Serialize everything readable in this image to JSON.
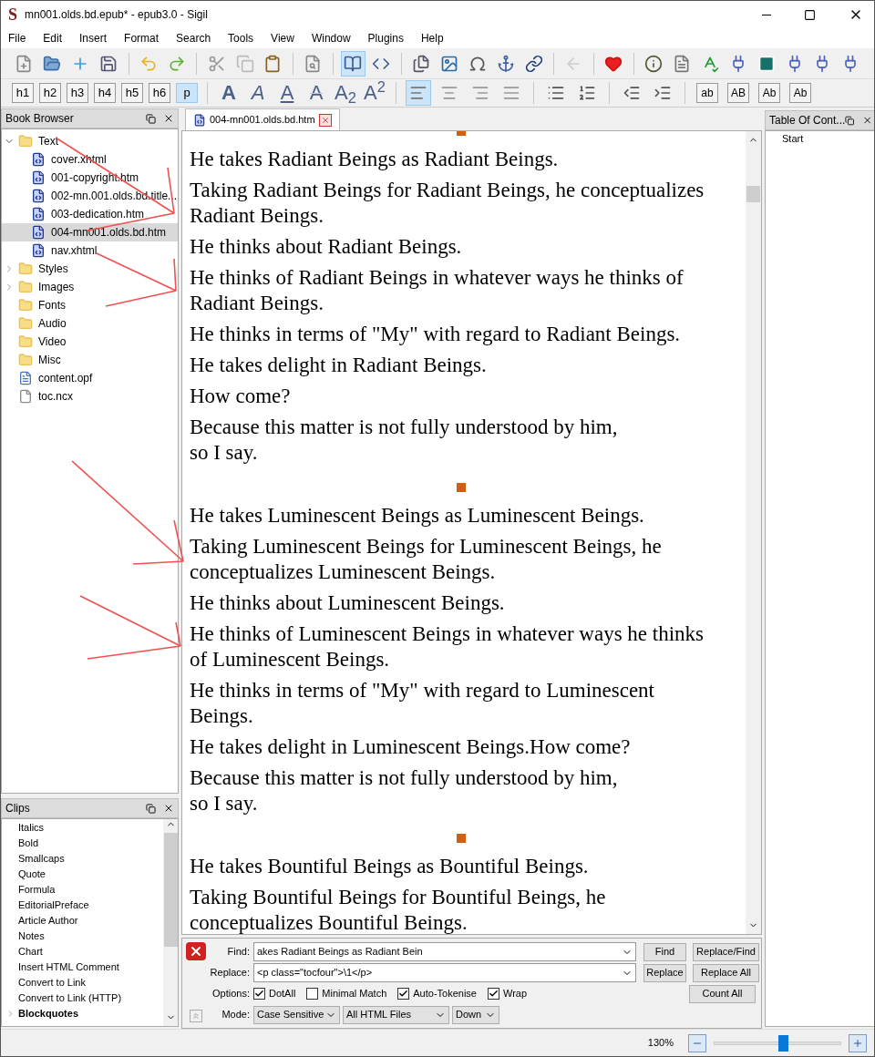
{
  "window": {
    "logo": "S",
    "title": "mn001.olds.bd.epub* - epub3.0 - Sigil"
  },
  "menu": [
    "File",
    "Edit",
    "Insert",
    "Format",
    "Search",
    "Tools",
    "View",
    "Window",
    "Plugins",
    "Help"
  ],
  "heading_buttons": [
    {
      "label": "h1",
      "selected": false
    },
    {
      "label": "h2",
      "selected": false
    },
    {
      "label": "h3",
      "selected": false
    },
    {
      "label": "h4",
      "selected": false
    },
    {
      "label": "h5",
      "selected": false
    },
    {
      "label": "h6",
      "selected": false
    },
    {
      "label": "p",
      "selected": true
    }
  ],
  "format_buttons": [
    {
      "label": "A",
      "kind": "bold"
    },
    {
      "label": "A",
      "kind": "italic"
    },
    {
      "label": "A",
      "kind": "underline"
    },
    {
      "label": "A",
      "kind": "strike"
    },
    {
      "label": "A$_{2}$",
      "kind": "plain"
    },
    {
      "label": "A$^{2}$",
      "kind": "plain"
    }
  ],
  "case_buttons": [
    "ab",
    "AB",
    "Ab",
    "Ab"
  ],
  "book_browser": {
    "title": "Book Browser",
    "items": [
      {
        "name": "Text",
        "kind": "folder",
        "expanded": true,
        "selected": false,
        "children": [
          {
            "name": "cover.xhtml",
            "kind": "html",
            "selected": false
          },
          {
            "name": "001-copyright.htm",
            "kind": "html",
            "selected": false
          },
          {
            "name": "002-mn.001.olds.bd.title....",
            "kind": "html",
            "selected": false
          },
          {
            "name": "003-dedication.htm",
            "kind": "html",
            "selected": false
          },
          {
            "name": "004-mn001.olds.bd.htm",
            "kind": "html",
            "selected": true
          },
          {
            "name": "nav.xhtml",
            "kind": "html",
            "selected": false
          }
        ]
      },
      {
        "name": "Styles",
        "kind": "folder",
        "expanded": false,
        "selected": false
      },
      {
        "name": "Images",
        "kind": "folder",
        "expanded": false,
        "selected": false
      },
      {
        "name": "Fonts",
        "kind": "folder",
        "selected": false
      },
      {
        "name": "Audio",
        "kind": "folder",
        "selected": false
      },
      {
        "name": "Video",
        "kind": "folder",
        "selected": false
      },
      {
        "name": "Misc",
        "kind": "folder",
        "selected": false
      },
      {
        "name": "content.opf",
        "kind": "opf",
        "selected": false
      },
      {
        "name": "toc.ncx",
        "kind": "file",
        "selected": false
      }
    ]
  },
  "clips": {
    "title": "Clips",
    "items": [
      {
        "name": "Italics",
        "kind": "clip"
      },
      {
        "name": "Bold",
        "kind": "clip"
      },
      {
        "name": "Smallcaps",
        "kind": "clip"
      },
      {
        "name": "Quote",
        "kind": "clip"
      },
      {
        "name": "Formula",
        "kind": "clip"
      },
      {
        "name": "EditorialPreface",
        "kind": "clip"
      },
      {
        "name": "Article Author",
        "kind": "clip"
      },
      {
        "name": "Notes",
        "kind": "clip"
      },
      {
        "name": "Chart",
        "kind": "clip"
      },
      {
        "name": "Insert HTML Comment",
        "kind": "clip"
      },
      {
        "name": "Convert to Link",
        "kind": "clip"
      },
      {
        "name": "Convert to Link (HTTP)",
        "kind": "clip"
      },
      {
        "name": "Blockquotes",
        "kind": "group"
      }
    ]
  },
  "editor": {
    "tab": "004-mn001.olds.bd.htm",
    "sections": [
      {
        "paragraphs": [
          [
            "He takes Radiant Beings as Radiant Beings."
          ],
          [
            "Taking Radiant Beings for Radiant Beings, he conceptualizes Radiant Beings."
          ],
          [
            "He thinks about Radiant Beings."
          ],
          [
            "He thinks of Radiant Beings in whatever ways he thinks of Radiant Beings."
          ],
          [
            "He thinks in terms of \"My\" with regard to Radiant Beings."
          ],
          [
            "He takes delight in Radiant Beings."
          ],
          [
            "How come?"
          ],
          [
            "Because this matter is not fully understood by him,",
            "so I say."
          ]
        ]
      },
      {
        "paragraphs": [
          [
            "He takes Luminescent Beings as Luminescent Beings."
          ],
          [
            "Taking Luminescent Beings for Luminescent Beings, he conceptualizes Luminescent Beings."
          ],
          [
            "He thinks about Luminescent Beings."
          ],
          [
            "He thinks of Luminescent Beings in whatever ways he thinks of Luminescent Beings."
          ],
          [
            "He thinks in terms of \"My\" with regard to Luminescent Beings."
          ],
          [
            "He takes delight in Luminescent Beings.How come?"
          ],
          [
            "Because this matter is not fully understood by him,",
            "so I say."
          ]
        ]
      },
      {
        "paragraphs": [
          [
            "He takes Bountiful Beings as Bountiful Beings."
          ],
          [
            "Taking Bountiful Beings for Bountiful Beings, he conceptualizes Bountiful Beings."
          ]
        ]
      }
    ]
  },
  "toc": {
    "title": "Table Of Cont...",
    "items": [
      "Start"
    ]
  },
  "find": {
    "find_label": "Find:",
    "find_value": "akes Radiant Beings as Radiant Bein",
    "replace_label": "Replace:",
    "replace_value": "<p class=\"tocfour\">\\1</p>",
    "buttons": [
      "Find",
      "Replace/Find",
      "Replace",
      "Replace All",
      "Count All"
    ],
    "options_label": "Options:",
    "options": [
      {
        "label": "DotAll",
        "checked": true
      },
      {
        "label": "Minimal Match",
        "checked": false
      },
      {
        "label": "Auto-Tokenise",
        "checked": true
      },
      {
        "label": "Wrap",
        "checked": true
      }
    ],
    "mode_label": "Mode:",
    "modes": [
      "Case Sensitive",
      "All HTML Files",
      "Down"
    ]
  },
  "status_bar": {
    "zoom": "130%",
    "level": 0.54
  }
}
